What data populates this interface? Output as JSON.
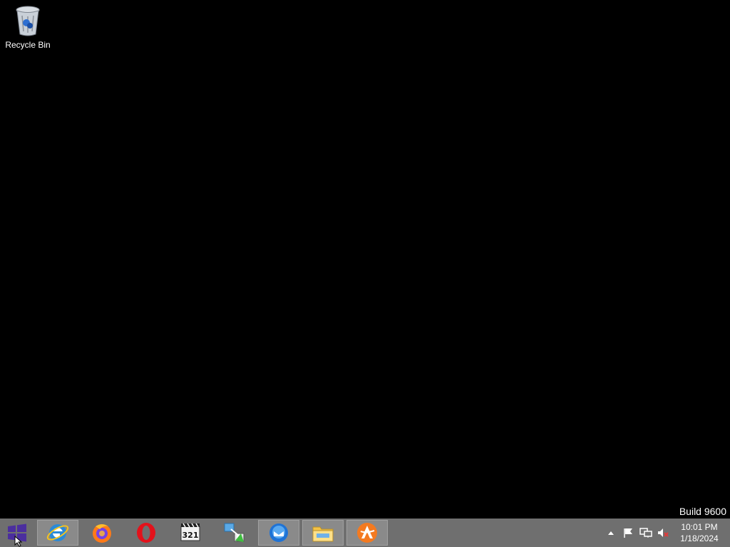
{
  "desktop": {
    "icons": [
      {
        "label": "Recycle Bin",
        "icon": "recycle-bin-icon"
      }
    ],
    "watermark": "Build 9600"
  },
  "taskbar": {
    "start_icon": "windows-logo-icon",
    "apps": [
      {
        "name": "Internet Explorer",
        "icon": "internet-explorer-icon"
      },
      {
        "name": "Firefox",
        "icon": "firefox-icon"
      },
      {
        "name": "Opera",
        "icon": "opera-icon"
      },
      {
        "name": "Media Player Classic",
        "icon": "media-player-icon"
      },
      {
        "name": "Transfer",
        "icon": "transfer-icon"
      },
      {
        "name": "Thunderbird",
        "icon": "thunderbird-icon"
      },
      {
        "name": "File Explorer",
        "icon": "file-explorer-icon"
      },
      {
        "name": "Avast",
        "icon": "avast-icon"
      }
    ],
    "tray": {
      "icons": [
        "show-hidden-icons-icon",
        "action-center-flag-icon",
        "network-icon",
        "volume-muted-icon"
      ],
      "time": "10:01 PM",
      "date": "1/18/2024"
    }
  },
  "colors": {
    "desktop_bg": "#000000",
    "taskbar_bg": "#6f6f6f",
    "start_accent": "#4b2e9e"
  }
}
